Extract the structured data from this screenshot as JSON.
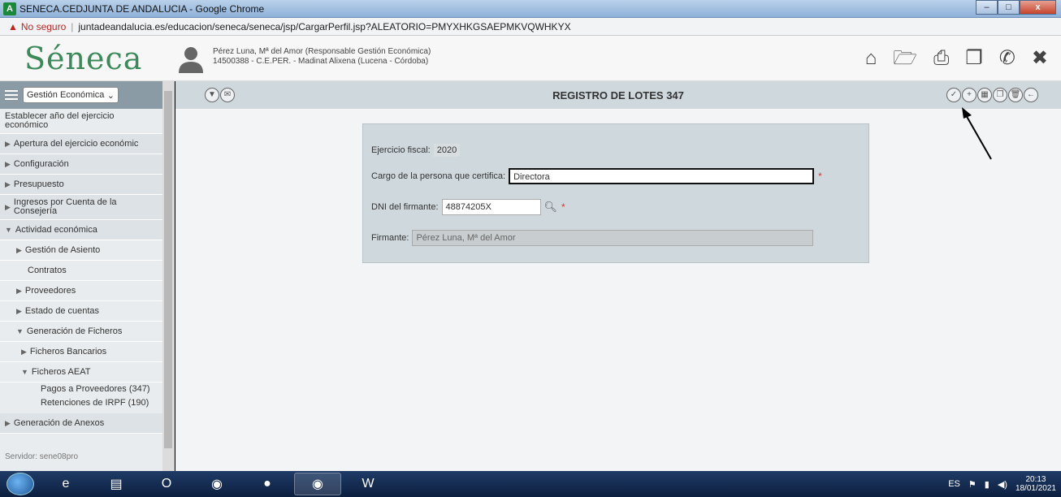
{
  "window": {
    "title": "SENECA.CEDJUNTA DE ANDALUCIA - Google Chrome",
    "app_icon": "A",
    "buttons": [
      "–",
      "□",
      "x"
    ]
  },
  "address_bar": {
    "insecure_label": "No seguro",
    "url": "juntadeandalucia.es/educacion/seneca/seneca/jsp/CargarPerfil.jsp?ALEATORIO=PMYXHKGSAEPMKVQWHKYX"
  },
  "header": {
    "logo_text": "Séneca",
    "user_line1": "Pérez Luna, Mª del Amor (Responsable Gestión Económica)",
    "user_line2": "14500388 - C.E.PER. - Madinat Alixena (Lucena - Córdoba)",
    "toolbar_icons": [
      "home-icon",
      "folder-icon",
      "print-icon",
      "windows-icon",
      "phone-icon",
      "close-icon"
    ]
  },
  "sidebar": {
    "selector": "Gestión Económica",
    "items": [
      {
        "label": "Establecer año del ejercicio económico",
        "type": "first"
      },
      {
        "label": "Apertura del ejercicio económic",
        "type": "collapsed"
      },
      {
        "label": "Configuración",
        "type": "collapsed"
      },
      {
        "label": "Presupuesto",
        "type": "collapsed"
      },
      {
        "label": "Ingresos por Cuenta de la Consejería",
        "type": "collapsed"
      },
      {
        "label": "Actividad económica",
        "type": "expanded"
      },
      {
        "label": "Gestión de Asiento",
        "type": "sub-collapsed"
      },
      {
        "label": "Contratos",
        "type": "sub-plain"
      },
      {
        "label": "Proveedores",
        "type": "sub-collapsed"
      },
      {
        "label": "Estado de cuentas",
        "type": "sub-collapsed"
      },
      {
        "label": "Generación de Ficheros",
        "type": "sub-expanded"
      },
      {
        "label": "Ficheros Bancarios",
        "type": "sub2-collapsed"
      },
      {
        "label": "Ficheros AEAT",
        "type": "sub2-expanded"
      },
      {
        "label": "Pagos a Proveedores (347)",
        "type": "leaf"
      },
      {
        "label": "Retenciones de IRPF (190)",
        "type": "leaf"
      },
      {
        "label": "Generación de Anexos",
        "type": "collapsed"
      }
    ],
    "server": "Servidor: sene08pro"
  },
  "main": {
    "title": "REGISTRO DE LOTES 347",
    "left_buttons": [
      "filter-icon",
      "mail-icon"
    ],
    "right_buttons": [
      "check-icon",
      "document-add-icon",
      "calculator-icon",
      "copy-icon",
      "trash-icon",
      "back-arrow-icon"
    ],
    "form": {
      "fiscal_year_label": "Ejercicio fiscal:",
      "fiscal_year_value": "2020",
      "cargo_label": "Cargo de la persona que certifica:",
      "cargo_value": "Directora",
      "dni_label": "DNI del firmante:",
      "dni_value": "48874205X",
      "firmante_label": "Firmante:",
      "firmante_value": "Pérez Luna, Mª del Amor",
      "required_mark": "*"
    }
  },
  "taskbar": {
    "tray_lang": "ES",
    "time": "20:13",
    "date": "18/01/2021"
  }
}
